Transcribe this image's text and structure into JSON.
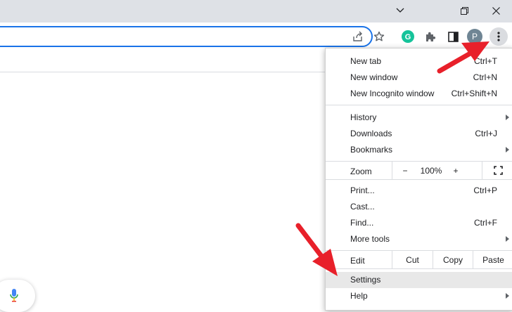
{
  "window": {
    "minimize_icon": "chevron-down",
    "restore_icon": "restore",
    "close_icon": "close"
  },
  "toolbar": {
    "profile_initial": "P"
  },
  "menu": {
    "new_tab": {
      "label": "New tab",
      "shortcut": "Ctrl+T"
    },
    "new_window": {
      "label": "New window",
      "shortcut": "Ctrl+N"
    },
    "new_incognito": {
      "label": "New Incognito window",
      "shortcut": "Ctrl+Shift+N"
    },
    "history": {
      "label": "History"
    },
    "downloads": {
      "label": "Downloads",
      "shortcut": "Ctrl+J"
    },
    "bookmarks": {
      "label": "Bookmarks"
    },
    "zoom": {
      "label": "Zoom",
      "minus": "−",
      "level": "100%",
      "plus": "+"
    },
    "print": {
      "label": "Print...",
      "shortcut": "Ctrl+P"
    },
    "cast": {
      "label": "Cast..."
    },
    "find": {
      "label": "Find...",
      "shortcut": "Ctrl+F"
    },
    "more_tools": {
      "label": "More tools"
    },
    "edit": {
      "label": "Edit",
      "cut": "Cut",
      "copy": "Copy",
      "paste": "Paste"
    },
    "settings": {
      "label": "Settings"
    },
    "help": {
      "label": "Help"
    }
  },
  "colors": {
    "accent": "#1a73e8",
    "arrow": "#e8202a",
    "grammarly": "#15c39a",
    "avatar": "#6f8594"
  }
}
